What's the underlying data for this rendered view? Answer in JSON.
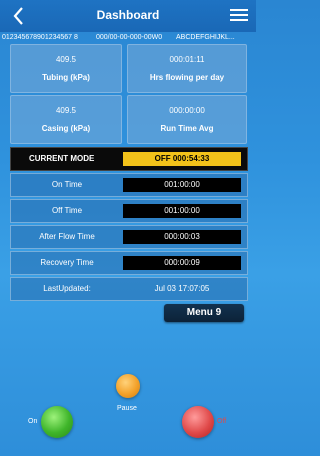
{
  "header": {
    "title": "Dashboard"
  },
  "subheader": {
    "left": "012345678901234567 8",
    "mid": "000/00-00-000-00W0",
    "right": "ABCDEFGHIJKL..."
  },
  "cards": [
    {
      "value": "409.5",
      "label": "Tubing (kPa)"
    },
    {
      "value": "000:01:11",
      "label": "Hrs flowing per day"
    },
    {
      "value": "409.5",
      "label": "Casing (kPa)"
    },
    {
      "value": "000:00:00",
      "label": "Run Time Avg"
    }
  ],
  "mode": {
    "label": "CURRENT MODE",
    "value": "OFF 000:54:33",
    "value_color": "#f2c21a"
  },
  "rows": [
    {
      "label": "On Time",
      "value": "001:00:00"
    },
    {
      "label": "Off Time",
      "value": "001:00:00"
    },
    {
      "label": "After Flow Time",
      "value": "000:00:03"
    },
    {
      "label": "Recovery Time",
      "value": "000:00:09"
    }
  ],
  "updated": {
    "label": "LastUpdated:",
    "value": "Jul 03 17:07:05"
  },
  "menu_button": "Menu 9",
  "controls": {
    "on": "On",
    "pause": "Pause",
    "off": "Off"
  },
  "colors": {
    "on": "#3fb52a",
    "pause": "#f3a129",
    "off": "#e04a4a"
  }
}
